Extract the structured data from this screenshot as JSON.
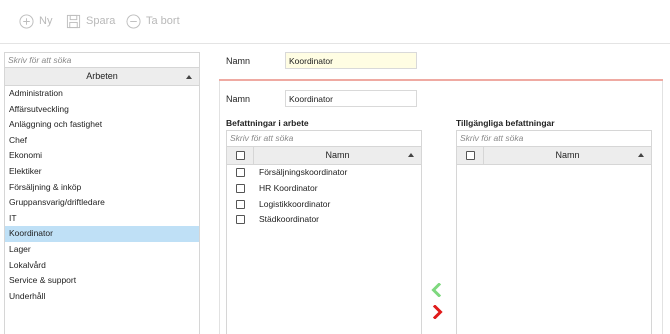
{
  "toolbar": {
    "new_label": "Ny",
    "save_label": "Spara",
    "delete_label": "Ta bort"
  },
  "left_panel": {
    "search_placeholder": "Skriv för att söka",
    "column_header": "Arbeten",
    "items": [
      {
        "label": "Administration",
        "selected": false
      },
      {
        "label": "Affärsutveckling",
        "selected": false
      },
      {
        "label": "Anläggning och fastighet",
        "selected": false
      },
      {
        "label": "Chef",
        "selected": false
      },
      {
        "label": "Ekonomi",
        "selected": false
      },
      {
        "label": "Elektiker",
        "selected": false
      },
      {
        "label": "Försäljning & inköp",
        "selected": false
      },
      {
        "label": "Gruppansvarig/driftledare",
        "selected": false
      },
      {
        "label": "IT",
        "selected": false
      },
      {
        "label": "Koordinator",
        "selected": true
      },
      {
        "label": "Lager",
        "selected": false
      },
      {
        "label": "Lokalvård",
        "selected": false
      },
      {
        "label": "Service & support",
        "selected": false
      },
      {
        "label": "Underhåll",
        "selected": false
      }
    ]
  },
  "main": {
    "name_label": "Namn",
    "name_value": "Koordinator",
    "inner_name_label": "Namn",
    "inner_name_value": "Koordinator",
    "positions_in_work": {
      "title": "Befattningar i arbete",
      "search_placeholder": "Skriv för att söka",
      "column_header": "Namn",
      "rows": [
        "Försäljningskoordinator",
        "HR Koordinator",
        "Logistikkoordinator",
        "Städkoordinator"
      ]
    },
    "available_positions": {
      "title": "Tillgängliga befattningar",
      "search_placeholder": "Skriv för att söka",
      "column_header": "Namn",
      "rows": []
    },
    "colors": {
      "selected_row": "#bfe0f6",
      "accent_line": "#efaaa2",
      "move_left_arrow": "#7ed87e",
      "move_right_arrow": "#e01b1b",
      "name_field_highlight": "#fffde3"
    }
  }
}
